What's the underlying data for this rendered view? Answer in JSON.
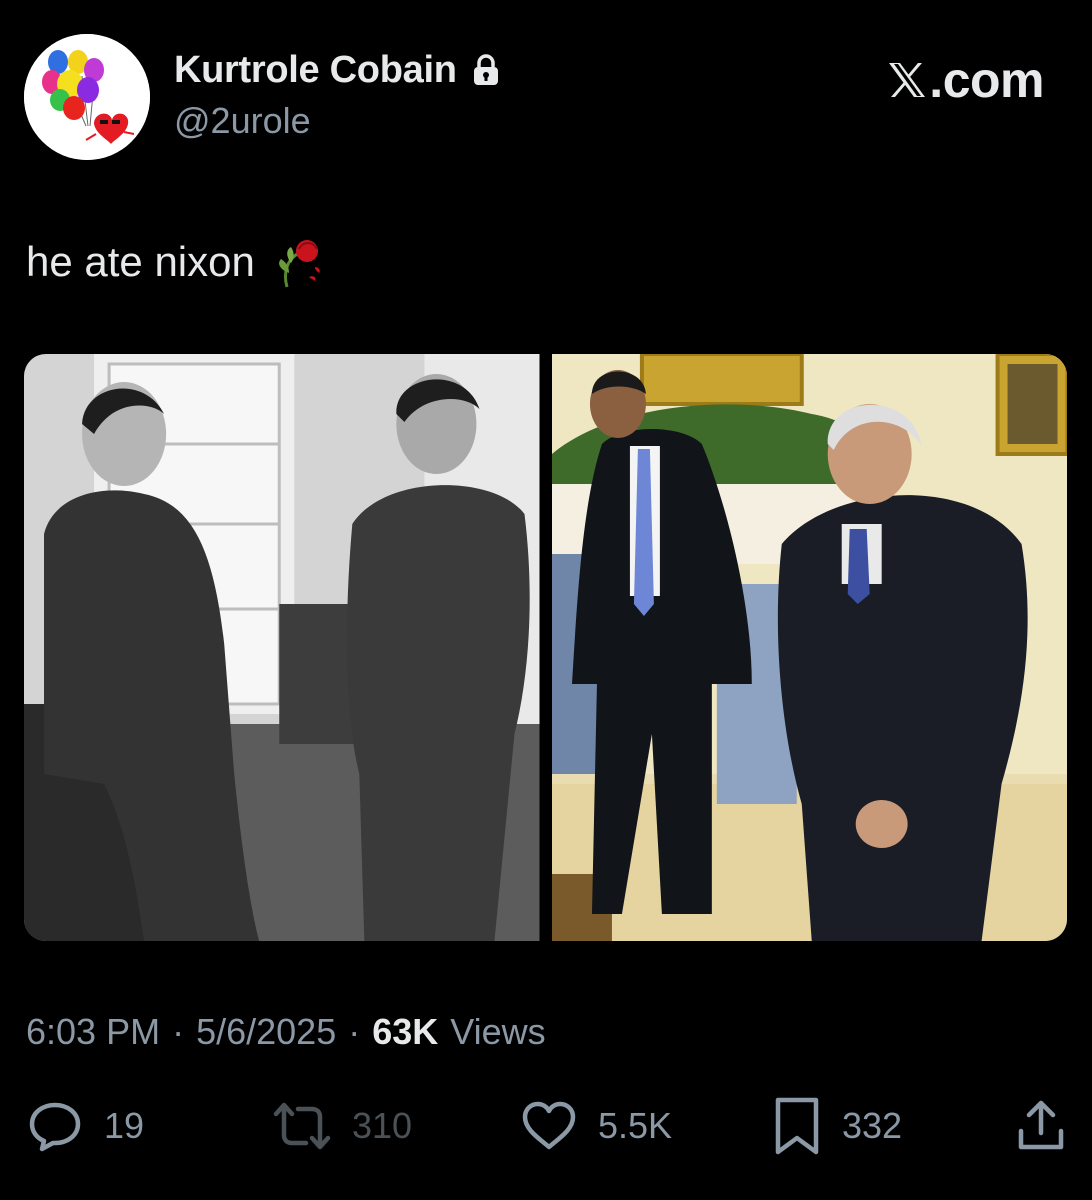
{
  "brand": {
    "text": ".com",
    "icon": "x-logo-icon"
  },
  "author": {
    "display_name": "Kurtrole Cobain",
    "handle": "@2urole",
    "protected_icon": "lock-icon",
    "avatar_icon": "balloons-heart-avatar"
  },
  "post": {
    "text": "he ate nixon",
    "emoji_icon": "wilted-rose-icon"
  },
  "media": [
    {
      "icon": "photo",
      "style": "black-and-white"
    },
    {
      "icon": "photo",
      "style": "color"
    }
  ],
  "meta": {
    "time": "6:03 PM",
    "separator": "·",
    "date": "5/6/2025",
    "views_count": "63K",
    "views_label": "Views"
  },
  "actions": {
    "reply": {
      "icon": "reply-icon",
      "count": "19"
    },
    "repost": {
      "icon": "repost-icon",
      "count": "310"
    },
    "like": {
      "icon": "heart-icon",
      "count": "5.5K"
    },
    "bookmark": {
      "icon": "bookmark-icon",
      "count": "332"
    },
    "share": {
      "icon": "share-icon"
    }
  },
  "colors": {
    "background": "#000000",
    "text": "#e7e9ea",
    "secondary": "#8b98a5",
    "dimmed": "#4a5157"
  }
}
